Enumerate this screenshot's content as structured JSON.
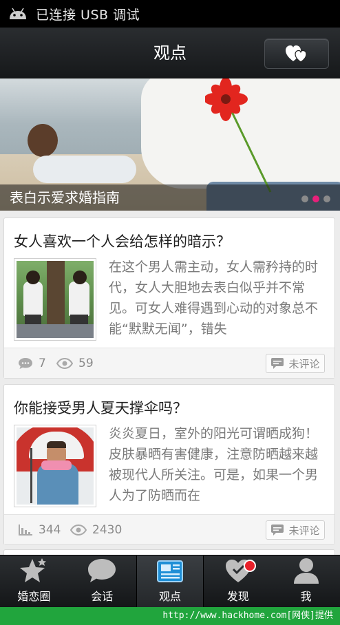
{
  "status_bar": {
    "text": "已连接 USB 调试"
  },
  "header": {
    "title": "观点"
  },
  "banner": {
    "caption": "表白示爱求婚指南",
    "page_count": 3,
    "active_index": 1
  },
  "articles": [
    {
      "title": "女人喜欢一个人会给怎样的暗示？",
      "excerpt": "在这个男人需主动，女人需矜持的时代，女人大胆地去表白似乎并不常见。可女人难得遇到心动的对象总不能“默默无闻”，错失",
      "stat1": "7",
      "stat2": "59",
      "comment_label": "未评论"
    },
    {
      "title": "你能接受男人夏天撑伞吗？",
      "excerpt": "炎炎夏日，室外的阳光可谓晒成狗！皮肤暴晒有害健康，注意防晒越来越被现代人所关注。可是，如果一个男人为了防晒而在",
      "stat1": "344",
      "stat2": "2430",
      "comment_label": "未评论"
    }
  ],
  "tabs": [
    {
      "label": "婚恋圈",
      "icon": "star-icon"
    },
    {
      "label": "会话",
      "icon": "chat-bubble-icon"
    },
    {
      "label": "观点",
      "icon": "newspaper-icon"
    },
    {
      "label": "发现",
      "icon": "heart-icon"
    },
    {
      "label": "我",
      "icon": "person-icon"
    }
  ],
  "watermark": "http://www.hackhome.com[网侠]提供",
  "colors": {
    "accent_pink": "#e8207a",
    "badge_red": "#e8202a",
    "watermark_green": "#21a53d"
  }
}
